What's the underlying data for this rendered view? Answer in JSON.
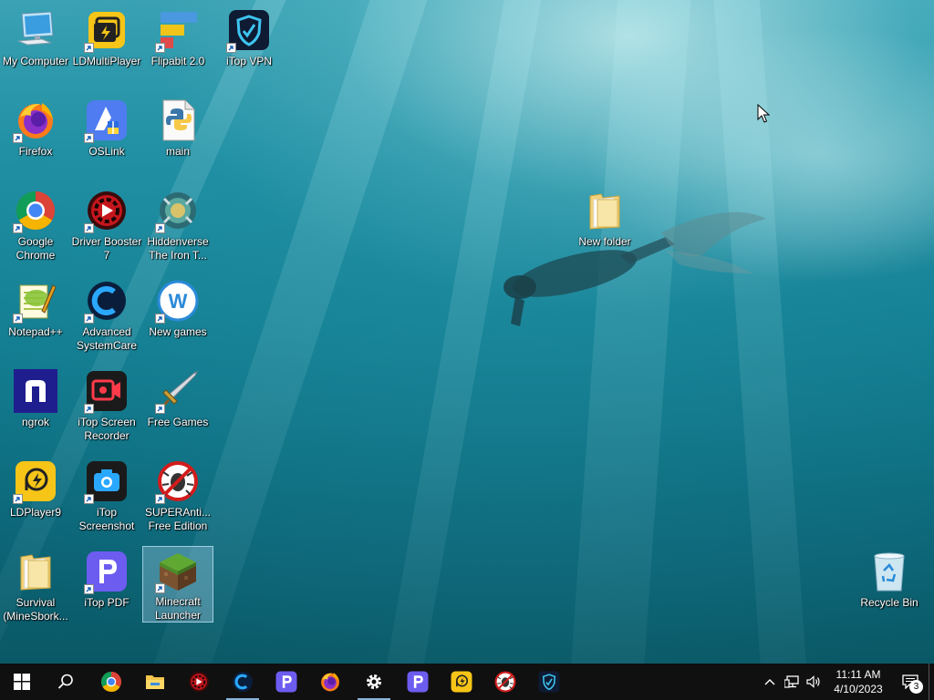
{
  "desktop": {
    "icons": [
      {
        "label": "My Computer",
        "icon": "computer-icon",
        "shortcut": false
      },
      {
        "label": "LDMultiPlayer",
        "icon": "ldmultiplayer-icon",
        "shortcut": true
      },
      {
        "label": "Flipabit 2.0",
        "icon": "flipabit-icon",
        "shortcut": true
      },
      {
        "label": "iTop VPN",
        "icon": "itop-vpn-icon",
        "shortcut": true
      },
      {
        "label": "Firefox",
        "icon": "firefox-icon",
        "shortcut": true
      },
      {
        "label": "OSLink",
        "icon": "oslink-icon",
        "shortcut": true
      },
      {
        "label": "main",
        "icon": "python-file-icon",
        "shortcut": false
      },
      {
        "label": "Google Chrome",
        "icon": "chrome-icon",
        "shortcut": true
      },
      {
        "label": "Driver Booster 7",
        "icon": "driver-booster-icon",
        "shortcut": true
      },
      {
        "label": "Hiddenverse The Iron T...",
        "icon": "hiddenverse-icon",
        "shortcut": true
      },
      {
        "label": "Notepad++",
        "icon": "notepad-plus-plus-icon",
        "shortcut": true
      },
      {
        "label": "Advanced SystemCare",
        "icon": "advanced-systemcare-icon",
        "shortcut": true
      },
      {
        "label": "New games",
        "icon": "new-games-icon",
        "shortcut": true
      },
      {
        "label": "ngrok",
        "icon": "ngrok-icon",
        "shortcut": false
      },
      {
        "label": "iTop Screen Recorder",
        "icon": "itop-screen-recorder-icon",
        "shortcut": true
      },
      {
        "label": "Free Games",
        "icon": "free-games-sword-icon",
        "shortcut": true
      },
      {
        "label": "LDPlayer9",
        "icon": "ldplayer-icon",
        "shortcut": true
      },
      {
        "label": "iTop Screenshot",
        "icon": "itop-screenshot-icon",
        "shortcut": true
      },
      {
        "label": "SUPERAnti... Free Edition",
        "icon": "superantispyware-icon",
        "shortcut": true
      },
      {
        "label": "Survival (MineSbork...",
        "icon": "folder-icon",
        "shortcut": false
      },
      {
        "label": "iTop PDF",
        "icon": "itop-pdf-icon",
        "shortcut": true
      },
      {
        "label": "Minecraft Launcher",
        "icon": "minecraft-icon",
        "shortcut": true,
        "selected": true
      },
      {
        "label": "New folder",
        "icon": "folder-icon",
        "shortcut": false
      },
      {
        "label": "Recycle Bin",
        "icon": "recycle-bin-icon",
        "shortcut": false
      }
    ]
  },
  "taskbar": {
    "start": "windows-start-icon",
    "search": "search-icon",
    "pinned": [
      {
        "icon": "chrome-icon",
        "active": false
      },
      {
        "icon": "file-explorer-icon",
        "active": false
      },
      {
        "icon": "driver-booster-icon",
        "active": false
      },
      {
        "icon": "advanced-systemcare-icon",
        "active": true
      },
      {
        "icon": "itop-pdf-icon",
        "active": false
      },
      {
        "icon": "firefox-icon",
        "active": false
      },
      {
        "icon": "settings-gear-icon",
        "active": true
      },
      {
        "icon": "itop-pdf-icon",
        "active": false
      },
      {
        "icon": "ldplayer-icon",
        "active": false
      },
      {
        "icon": "superantispyware-icon",
        "active": false
      },
      {
        "icon": "itop-vpn-icon",
        "active": false
      }
    ],
    "tray": {
      "icons": [
        "chevron-up-icon",
        "network-icon",
        "volume-icon"
      ],
      "time": "11:11 AM",
      "date": "4/10/2023",
      "notification_count": "3"
    }
  },
  "colors": {
    "taskbar": "#101010",
    "selection": "#aad2eb",
    "water": "#137e92"
  }
}
